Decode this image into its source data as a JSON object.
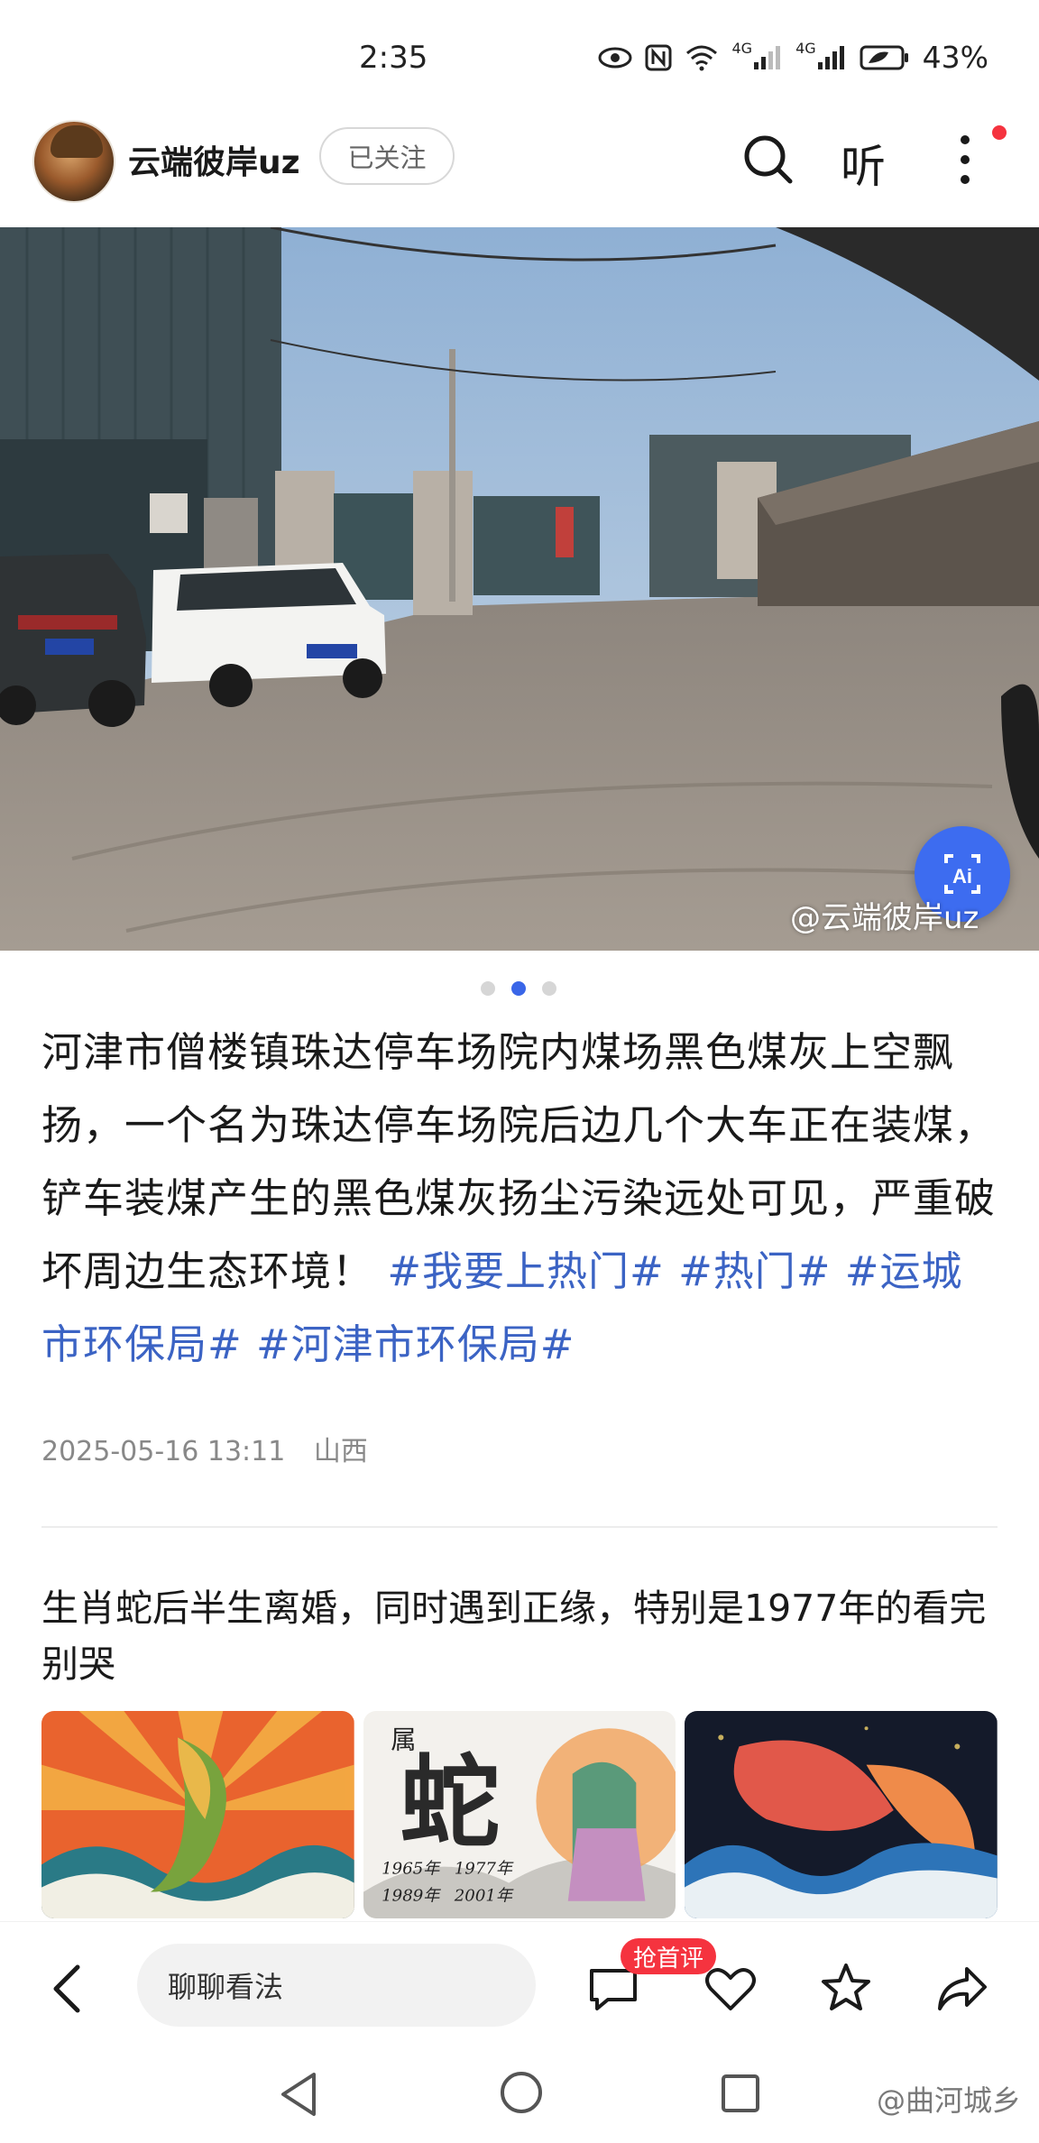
{
  "status_bar": {
    "time": "2:35",
    "network_1": "4G",
    "network_2": "4G",
    "battery": "43%",
    "icons": [
      "eye-icon",
      "nfc-icon",
      "wifi-icon",
      "signal-icon",
      "signal-icon",
      "battery-icon"
    ]
  },
  "header": {
    "username": "云端彼岸uz",
    "follow_label": "已关注",
    "listen_label": "听",
    "icons": [
      "search-icon",
      "more-icon"
    ],
    "has_notification_dot": true
  },
  "photo": {
    "watermark": "@云端彼岸uz",
    "ai_button_label": "Ai",
    "page_count": 3,
    "current_page": 2
  },
  "post": {
    "body": "河津市僧楼镇珠达停车场院内煤场黑色煤灰上空飘扬，一个名为珠达停车场院后边几个大车正在装煤，铲车装煤产生的黑色煤灰扬尘污染远处可见，严重破坏周边生态环境！",
    "tags": [
      "#我要上热门#",
      "#热门#",
      "#运城市环保局#",
      "#河津市环保局#"
    ],
    "date": "2025-05-16 13:11",
    "location": "山西"
  },
  "recommendation": {
    "title": "生肖蛇后半生离婚，同时遇到正缘，特别是1977年的看完别哭",
    "image_2_text": {
      "char_small": "属",
      "char_big": "蛇",
      "years": [
        "1965年",
        "1977年",
        "1989年",
        "2001年"
      ]
    }
  },
  "action_bar": {
    "comment_placeholder": "聊聊看法",
    "first_comment_badge": "抢首评",
    "icons": [
      "back-icon",
      "comment-icon",
      "like-icon",
      "favorite-icon",
      "share-icon"
    ]
  },
  "nav_bar": {
    "watermark": "@曲河城乡"
  },
  "colors": {
    "accent_blue": "#3b63c4",
    "ai_button": "#3d6cf0",
    "badge_red": "#f5333f"
  }
}
